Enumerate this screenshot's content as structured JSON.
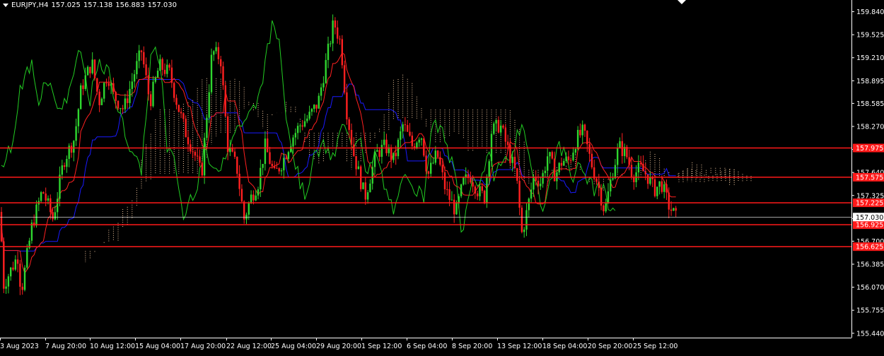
{
  "header": {
    "symbol": "EURJPY,H4",
    "open": "157.025",
    "high": "157.138",
    "low": "156.883",
    "close": "157.030"
  },
  "colors": {
    "background": "#000000",
    "axis": "#ffffff",
    "bull": "#2fd62f",
    "bear": "#ff2020",
    "level": "#ff1a1a",
    "tenkan": "#ff2020",
    "kijun": "#1a1aff",
    "chikou": "#22cc22",
    "cloud": "#f2c9a0",
    "price_label": "#ffffff"
  },
  "chart_data": {
    "type": "candlestick",
    "indicator": "Ichimoku",
    "y_ticks": [
      "159.840",
      "159.525",
      "159.210",
      "158.895",
      "158.585",
      "158.270",
      "157.955",
      "157.640",
      "157.325",
      "157.010",
      "156.700",
      "156.385",
      "156.070",
      "155.755",
      "155.440"
    ],
    "x_ticks": [
      "3 Aug 2023",
      "7 Aug 20:00",
      "10 Aug 12:00",
      "15 Aug 04:00",
      "17 Aug 20:00",
      "22 Aug 12:00",
      "25 Aug 04:00",
      "29 Aug 20:00",
      "1 Sep 12:00",
      "6 Sep 04:00",
      "8 Sep 20:00",
      "13 Sep 12:00",
      "18 Sep 04:00",
      "20 Sep 20:00",
      "25 Sep 12:00"
    ],
    "ylim": [
      155.38,
      160.0
    ],
    "levels": [
      {
        "label": "157.975",
        "value": 157.975
      },
      {
        "label": "157.575",
        "value": 157.575
      },
      {
        "label": "157.225",
        "value": 157.225
      },
      {
        "label": "156.925",
        "value": 156.925
      },
      {
        "label": "156.625",
        "value": 156.625
      }
    ],
    "current_price": {
      "label": "157.030",
      "value": 157.03
    },
    "price_anchors": [
      [
        0,
        157.1
      ],
      [
        5,
        156.1
      ],
      [
        15,
        156.3
      ],
      [
        25,
        156.5
      ],
      [
        30,
        156.0
      ],
      [
        45,
        156.9
      ],
      [
        60,
        157.4
      ],
      [
        75,
        157.0
      ],
      [
        90,
        157.8
      ],
      [
        105,
        158.1
      ],
      [
        115,
        158.8
      ],
      [
        130,
        159.15
      ],
      [
        140,
        158.6
      ],
      [
        152,
        159.0
      ],
      [
        160,
        158.7
      ],
      [
        175,
        158.5
      ],
      [
        190,
        159.0
      ],
      [
        200,
        159.3
      ],
      [
        212,
        158.6
      ],
      [
        225,
        159.1
      ],
      [
        240,
        159.0
      ],
      [
        250,
        158.6
      ],
      [
        262,
        158.2
      ],
      [
        275,
        157.9
      ],
      [
        285,
        157.6
      ],
      [
        300,
        159.3
      ],
      [
        312,
        159.2
      ],
      [
        322,
        158.0
      ],
      [
        335,
        157.7
      ],
      [
        345,
        157.0
      ],
      [
        355,
        157.3
      ],
      [
        365,
        157.5
      ],
      [
        375,
        158.0
      ],
      [
        388,
        157.6
      ],
      [
        400,
        157.8
      ],
      [
        412,
        158.1
      ],
      [
        425,
        158.3
      ],
      [
        437,
        158.4
      ],
      [
        450,
        158.6
      ],
      [
        460,
        159.1
      ],
      [
        472,
        159.7
      ],
      [
        482,
        159.4
      ],
      [
        490,
        158.5
      ],
      [
        500,
        157.9
      ],
      [
        508,
        157.6
      ],
      [
        516,
        157.3
      ],
      [
        524,
        157.6
      ],
      [
        532,
        157.9
      ],
      [
        545,
        158.0
      ],
      [
        557,
        157.8
      ],
      [
        570,
        158.3
      ],
      [
        583,
        158.0
      ],
      [
        595,
        158.2
      ],
      [
        605,
        157.6
      ],
      [
        618,
        157.9
      ],
      [
        630,
        157.4
      ],
      [
        645,
        157.1
      ],
      [
        655,
        157.5
      ],
      [
        665,
        157.6
      ],
      [
        675,
        157.4
      ],
      [
        685,
        157.3
      ],
      [
        695,
        158.2
      ],
      [
        707,
        158.3
      ],
      [
        720,
        157.9
      ],
      [
        730,
        157.6
      ],
      [
        738,
        156.8
      ],
      [
        745,
        157.1
      ],
      [
        755,
        157.6
      ],
      [
        765,
        157.5
      ],
      [
        775,
        157.9
      ],
      [
        785,
        157.6
      ],
      [
        795,
        157.8
      ],
      [
        805,
        157.8
      ],
      [
        815,
        158.1
      ],
      [
        825,
        158.2
      ],
      [
        835,
        157.8
      ],
      [
        845,
        157.5
      ],
      [
        855,
        157.1
      ],
      [
        865,
        157.6
      ],
      [
        875,
        158.0
      ],
      [
        885,
        157.9
      ],
      [
        895,
        157.6
      ],
      [
        905,
        157.7
      ],
      [
        915,
        157.6
      ],
      [
        925,
        157.4
      ],
      [
        935,
        157.5
      ],
      [
        945,
        157.2
      ],
      [
        957,
        157.0
      ]
    ]
  }
}
